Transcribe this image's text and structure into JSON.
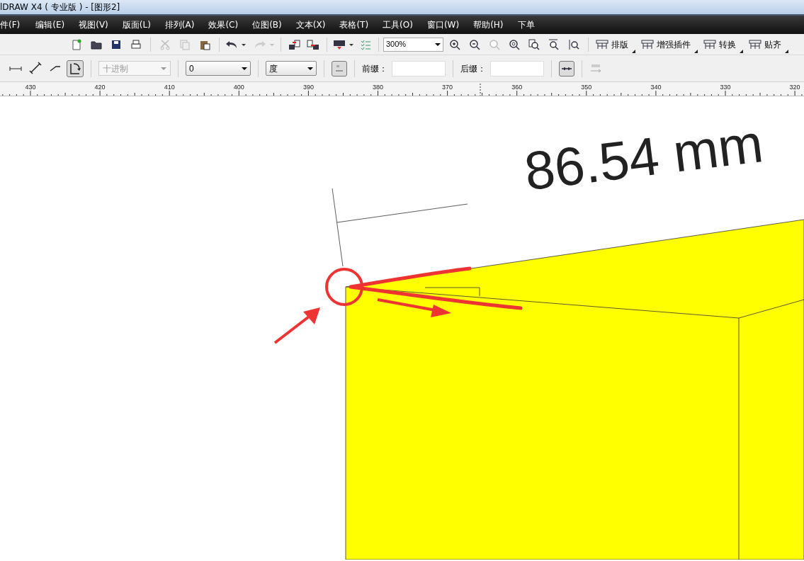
{
  "window": {
    "title": "lDRAW X4 ( 专业版 ) - [图形2]"
  },
  "menu": [
    "件(F)",
    "编辑(E)",
    "视图(V)",
    "版面(L)",
    "排列(A)",
    "效果(C)",
    "位图(B)",
    "文本(X)",
    "表格(T)",
    "工具(O)",
    "窗口(W)",
    "帮助(H)",
    "下单"
  ],
  "toolbar": {
    "zoom": "300%",
    "buttons": [
      "排版",
      "增强插件",
      "转换",
      "贴齐"
    ]
  },
  "property_bar": {
    "tools": [
      {
        "selected": false
      },
      {
        "selected": false
      },
      {
        "selected": false
      },
      {
        "selected": true
      }
    ],
    "number_format": {
      "value": "十进制",
      "disabled": true
    },
    "precision": "0",
    "unit": "度",
    "show_units": {
      "selected": true
    },
    "prefix_label": "前缀：",
    "suffix_label": "后缀：",
    "dynamic_dimension": {
      "selected": true
    }
  },
  "ruler": {
    "labels": [
      "430",
      "420",
      "410",
      "400",
      "390",
      "380",
      "370",
      "360",
      "350",
      "340",
      "330",
      "320"
    ]
  },
  "canvas": {
    "dimension_text": "86.54 mm"
  }
}
